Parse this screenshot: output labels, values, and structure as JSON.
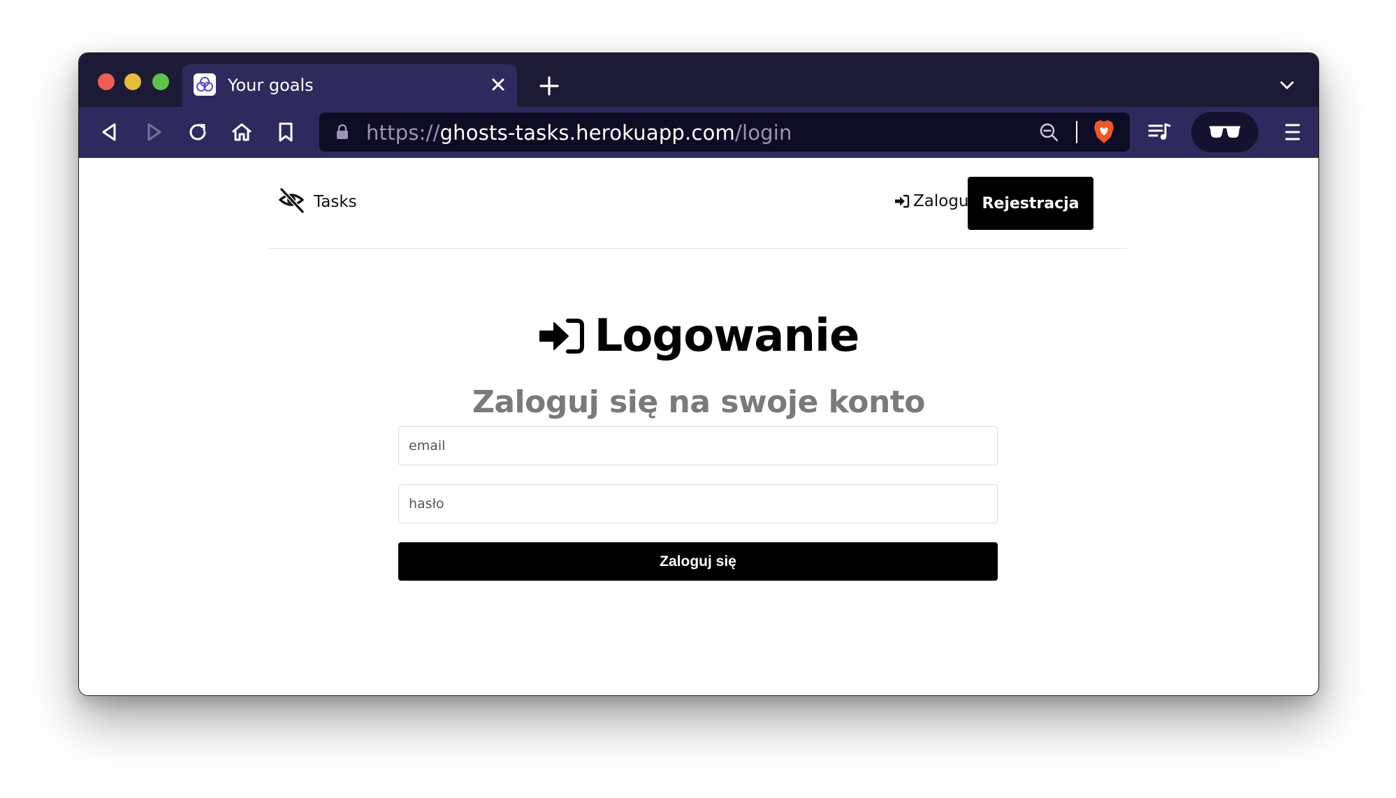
{
  "browser": {
    "tab": {
      "title": "Your goals"
    },
    "url": {
      "scheme": "https://",
      "host": "ghosts-tasks.herokuapp.com",
      "path": "/login"
    },
    "icons": {
      "back": "arrow-left-icon",
      "forward": "arrow-right-icon",
      "reload": "reload-icon",
      "home": "home-icon",
      "bookmark": "bookmark-icon",
      "lock": "lock-icon",
      "zoom": "zoom-out-icon",
      "shields": "brave-shield-icon",
      "media": "playlist-icon",
      "private": "sunglasses-icon",
      "menu": "hamburger-menu-icon"
    },
    "colors": {
      "tabstrip": "#1d1a36",
      "toolbar": "#2f2a5d",
      "urlbar": "#0e0c24"
    }
  },
  "nav": {
    "brand": "Tasks",
    "brand_icon": "eye-slash-icon",
    "login_label": "Zaloguj",
    "login_icon": "sign-in-icon",
    "register_label": "Rejestracja"
  },
  "login": {
    "title": "Logowanie",
    "title_icon": "sign-in-icon",
    "subtitle": "Zaloguj się na swoje konto",
    "email_placeholder": "email",
    "password_placeholder": "hasło",
    "submit_label": "Zaloguj się"
  }
}
